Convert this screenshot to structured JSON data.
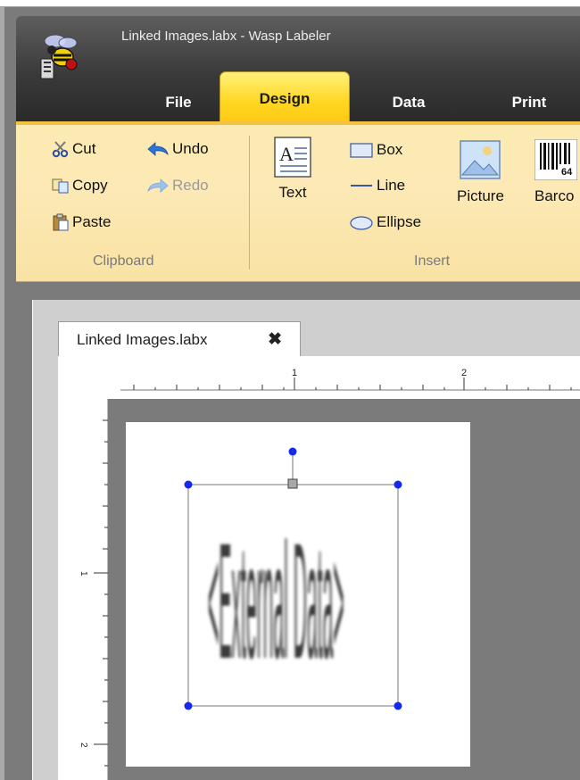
{
  "window": {
    "title": "Linked Images.labx - Wasp Labeler"
  },
  "tabs": [
    {
      "label": "File"
    },
    {
      "label": "Design"
    },
    {
      "label": "Data"
    },
    {
      "label": "Print"
    }
  ],
  "ribbon": {
    "clipboard": {
      "cut": "Cut",
      "copy": "Copy",
      "paste": "Paste",
      "undo": "Undo",
      "redo": "Redo",
      "group_label": "Clipboard"
    },
    "insert": {
      "text": "Text",
      "box": "Box",
      "line": "Line",
      "ellipse": "Ellipse",
      "picture": "Picture",
      "barcode": "Barco",
      "barcode_icon_digits": "64",
      "group_label": "Insert"
    }
  },
  "document": {
    "tab_label": "Linked Images.labx",
    "close_glyph": "✖",
    "ruler_h_labels": [
      "1",
      "2"
    ],
    "ruler_v_labels": [
      "1",
      "2"
    ],
    "image_placeholder_text": "<External Data>"
  },
  "colors": {
    "ribbon_bg": "#fce9b5",
    "active_tab": "#ffd620",
    "titlebar": "#3a3a3a",
    "handle_blue": "#1428f0"
  }
}
